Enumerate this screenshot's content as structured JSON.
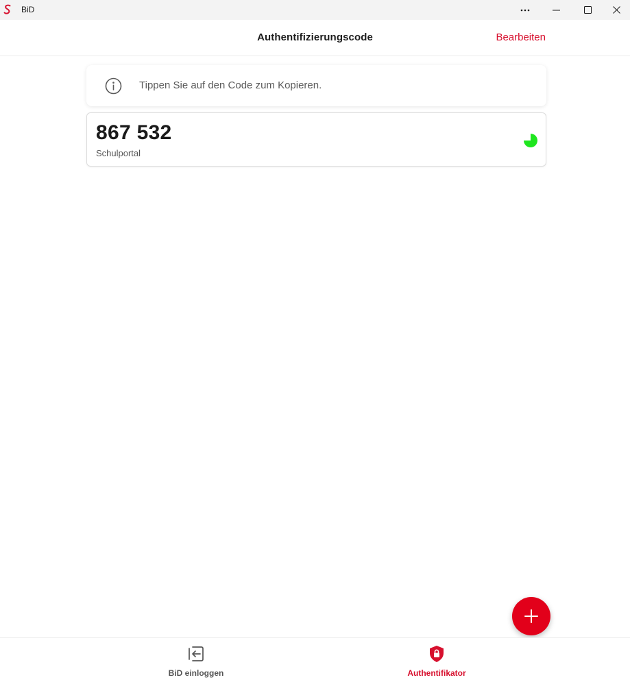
{
  "window": {
    "title": "BiD",
    "controls": [
      "more-icon",
      "minimize-icon",
      "maximize-icon",
      "close-icon"
    ]
  },
  "header": {
    "title": "Authentifizierungscode",
    "edit_label": "Bearbeiten"
  },
  "info": {
    "icon": "info-icon",
    "text": "Tippen Sie auf den Code zum Kopieren."
  },
  "codes": [
    {
      "code": "867 532",
      "label": "Schulportal",
      "timer_icon": "countdown-pie-icon",
      "timer_remaining_fraction": 0.75
    }
  ],
  "fab": {
    "icon": "plus-icon"
  },
  "bottom_nav": {
    "items": [
      {
        "label": "BiD einloggen",
        "icon": "login-arrow-icon",
        "active": false
      },
      {
        "label": "Authentifikator",
        "icon": "shield-lock-icon",
        "active": true
      }
    ]
  },
  "colors": {
    "accent": "#e2001a",
    "accent_text": "#d7102e",
    "timer": "#1ee61e",
    "titlebar": "#f3f3f3"
  }
}
